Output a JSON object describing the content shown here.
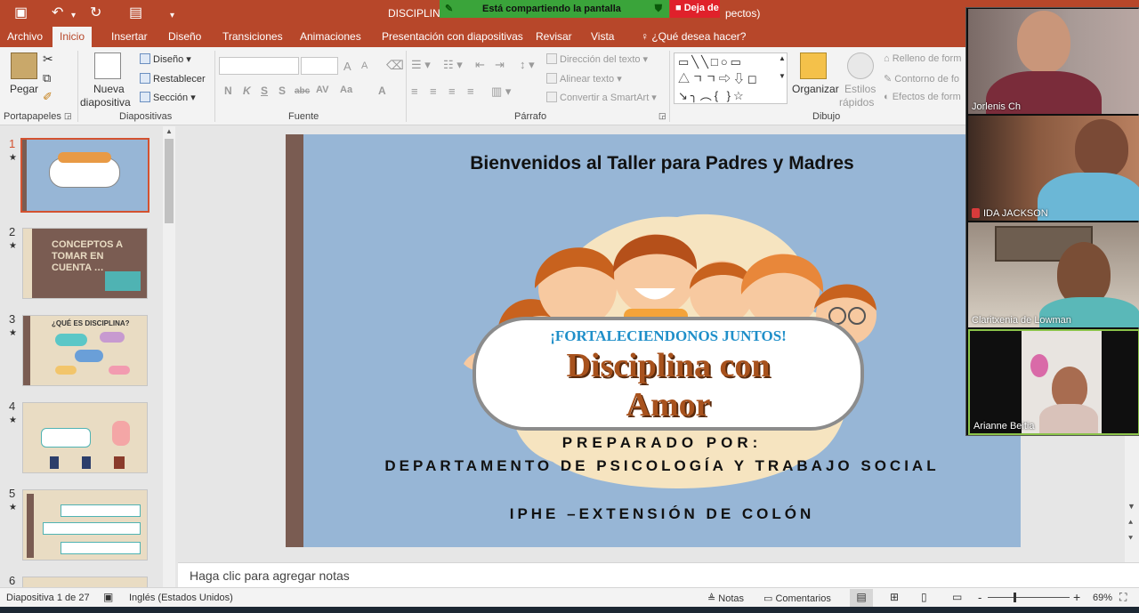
{
  "titlebar": {
    "doc_title": "DISCIPLINA",
    "doc_title_suffix": "pectos)",
    "share_label": "Está compartiendo la pantalla",
    "stop_share_label": "Deja de"
  },
  "tabs": [
    "Archivo",
    "Inicio",
    "Insertar",
    "Diseño",
    "Transiciones",
    "Animaciones",
    "Presentación con diapositivas",
    "Revisar",
    "Vista",
    "¿Qué desea hacer?"
  ],
  "ribbon": {
    "clipboard": {
      "paste": "Pegar",
      "label": "Portapapeles"
    },
    "slides": {
      "new_1": "Nueva",
      "new_2": "diapositiva",
      "layout": "Diseño",
      "reset": "Restablecer",
      "section": "Sección",
      "label": "Diapositivas"
    },
    "font": {
      "label": "Fuente",
      "b": "N",
      "i": "K",
      "u": "S",
      "s": "S",
      "strike": "abc",
      "spacing": "AV",
      "case": "Aa",
      "color": "A",
      "grow": "A",
      "shrink": "A"
    },
    "paragraph": {
      "direction": "Dirección del texto",
      "align": "Alinear texto",
      "smartart": "Convertir a SmartArt",
      "label": "Párrafo"
    },
    "drawing": {
      "arrange": "Organizar",
      "styles_1": "Estilos",
      "styles_2": "rápidos",
      "fill": "Relleno de form",
      "outline": "Contorno de fo",
      "effects": "Efectos de form",
      "label": "Dibujo"
    }
  },
  "slides_panel": {
    "numbers": [
      "1",
      "2",
      "3",
      "4",
      "5",
      "6"
    ],
    "thumb2_title": "CONCEPTOS A TOMAR EN CUENTA …",
    "thumb3_title": "¿QUÉ ES DISCIPLINA?"
  },
  "slide": {
    "header": "Bienvenidos al  Taller para Padres y Madres",
    "slogan": "¡FORTALECIENDONOS JUNTOS!",
    "title_line1": "Disciplina con",
    "title_line2": "Amor",
    "prepared": "PREPARADO POR:",
    "department": "DEPARTAMENTO DE PSICOLOGÍA Y TRABAJO SOCIAL",
    "institution": "IPHE –EXTENSIÓN DE COLÓN"
  },
  "notes_placeholder": "Haga clic para agregar notas",
  "status": {
    "slide_count": "Diapositiva 1 de 27",
    "language": "Inglés (Estados Unidos)",
    "notes": "Notas",
    "comments": "Comentarios",
    "zoom": "69%",
    "zoom_level": 0.69
  },
  "participants": [
    {
      "name": "Jorlenis Ch",
      "muted": false
    },
    {
      "name": "IDA JACKSON",
      "muted": true
    },
    {
      "name": "Claritxenia de Lowman",
      "muted": false
    },
    {
      "name": "Arianne Beitia",
      "muted": false
    }
  ],
  "colors": {
    "accent": "#b7472a",
    "slide_bg": "#97b6d6",
    "title_brown": "#a8521d",
    "share_green": "#3aa43a",
    "stop_red": "#e0212b"
  }
}
